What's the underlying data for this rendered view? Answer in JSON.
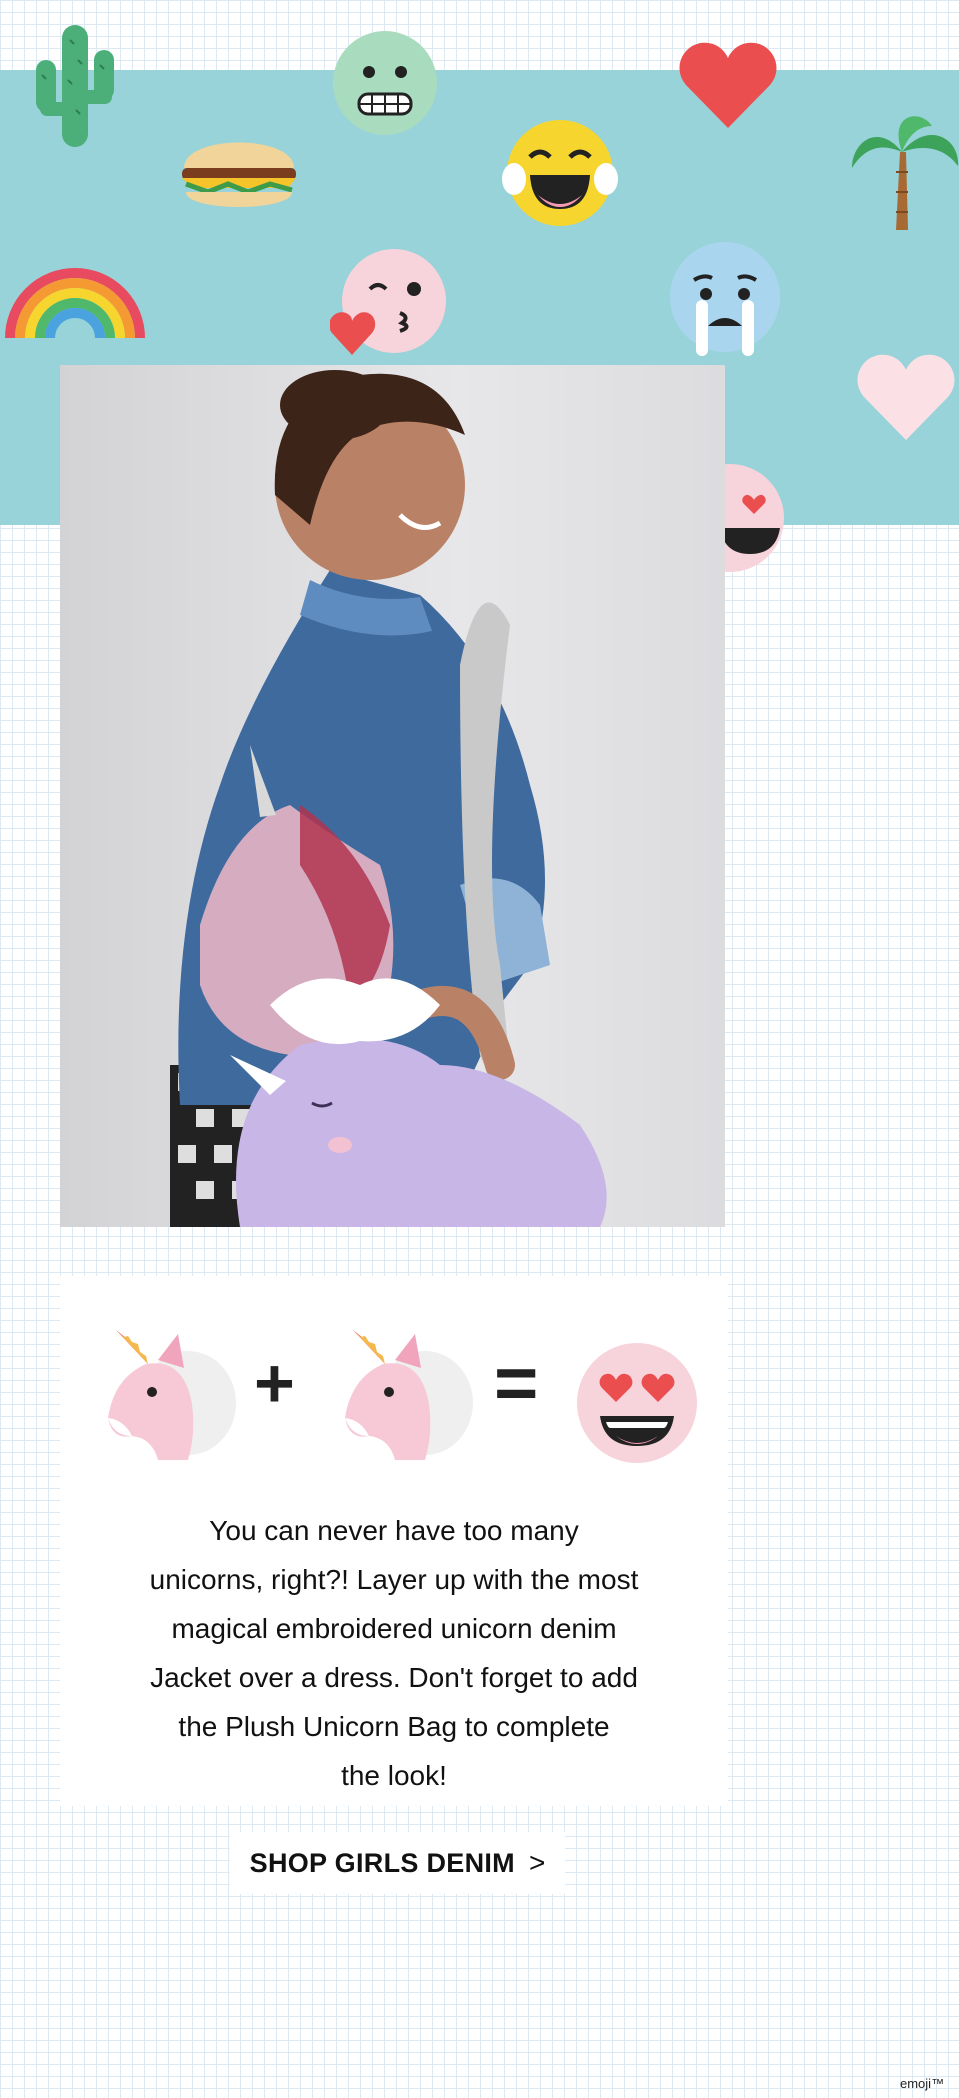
{
  "hero": {
    "emojis": [
      "cactus-icon",
      "grimace-face-icon",
      "heart-icon",
      "burger-icon",
      "tears-of-joy-face-icon",
      "palm-tree-icon",
      "rainbow-icon",
      "kiss-face-icon",
      "crying-face-icon",
      "pale-heart-icon",
      "heart-eyes-face-icon"
    ]
  },
  "photo": {
    "subject": "product-photo"
  },
  "equation": {
    "plus": "+",
    "equals": "="
  },
  "blurb": {
    "lines": [
      "You can never have too many",
      "unicorns, right?! Layer up with the most",
      "magical embroidered unicorn denim",
      "Jacket over a dress. Don't forget to add",
      "the Plush Unicorn Bag to complete",
      "the look!"
    ]
  },
  "cta": {
    "label": "SHOP GIRLS DENIM",
    "chevron": ">"
  },
  "footer": {
    "trademark": "emoji™"
  },
  "colors": {
    "teal": "#97d3d8",
    "grid": "#dce9f3",
    "heart": "#e94b4b"
  }
}
